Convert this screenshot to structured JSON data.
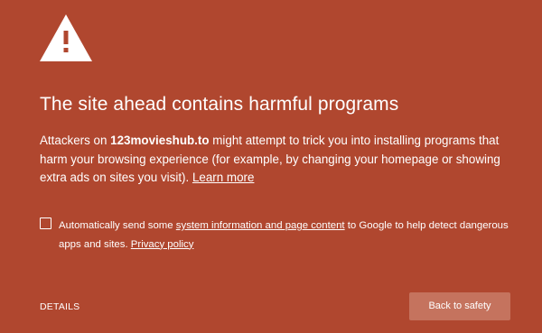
{
  "colors": {
    "background": "#b0472f",
    "text": "#ffffff",
    "button_background": "#c5735e"
  },
  "header": {
    "icon": "warning-triangle-icon",
    "title": "The site ahead contains harmful programs"
  },
  "main": {
    "prefix": "Attackers on ",
    "site": "123movieshub.to",
    "suffix": " might attempt to trick you into installing programs that harm your browsing experience (for example, by changing your homepage or showing extra ads on sites you visit). ",
    "learn_more": "Learn more"
  },
  "report": {
    "checked": false,
    "prefix": "Automatically send some ",
    "link": "system information and page content",
    "middle": " to Google to help detect dangerous apps and sites. ",
    "privacy_link": "Privacy policy"
  },
  "footer": {
    "details_label": "DETAILS",
    "back_label": "Back to safety"
  }
}
